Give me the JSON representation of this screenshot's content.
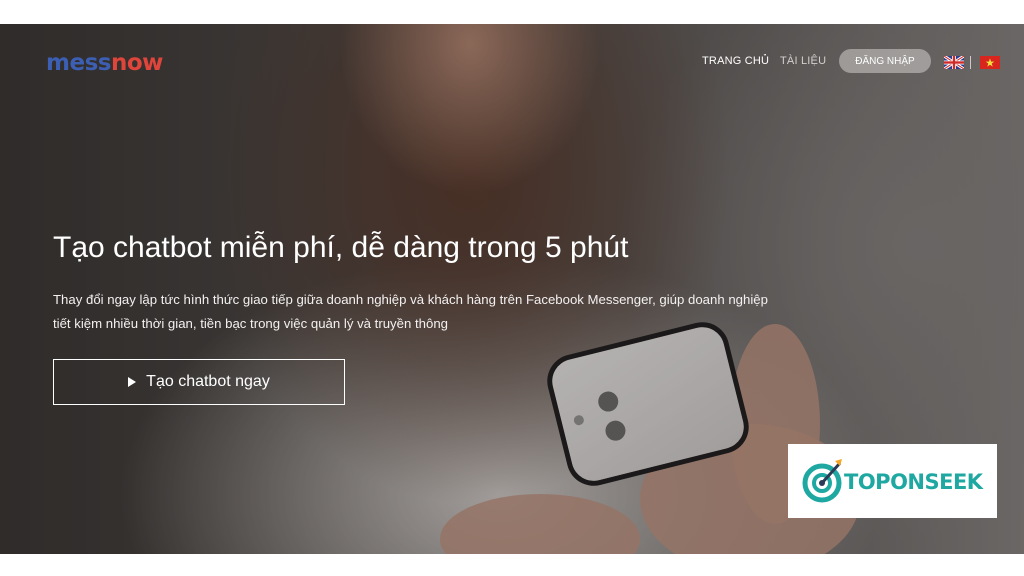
{
  "brand": {
    "part1": "mess",
    "part2": "now",
    "color1": "#3c5fb3",
    "color2": "#e0453b"
  },
  "nav": {
    "home": "TRANG CHỦ",
    "docs": "TÀI LIỆU",
    "login": "ĐĂNG NHẬP",
    "flags": [
      {
        "icon": "uk-flag-icon"
      },
      {
        "icon": "vietnam-flag-icon"
      }
    ]
  },
  "hero": {
    "headline": "Tạo chatbot miễn phí, dễ dàng trong 5 phút",
    "subtext": "Thay đổi ngay lập tức hình thức giao tiếp giữa doanh nghiệp và khách hàng trên Facebook Messenger, giúp doanh nghiệp tiết kiệm nhiều thời gian, tiền bạc trong việc quản lý và truyền thông",
    "cta_label": "Tạo chatbot ngay",
    "cta_icon": "play-icon"
  },
  "watermark": {
    "text": "TOPONSEEK",
    "icon": "target-icon",
    "color": "#1fa8a2"
  }
}
